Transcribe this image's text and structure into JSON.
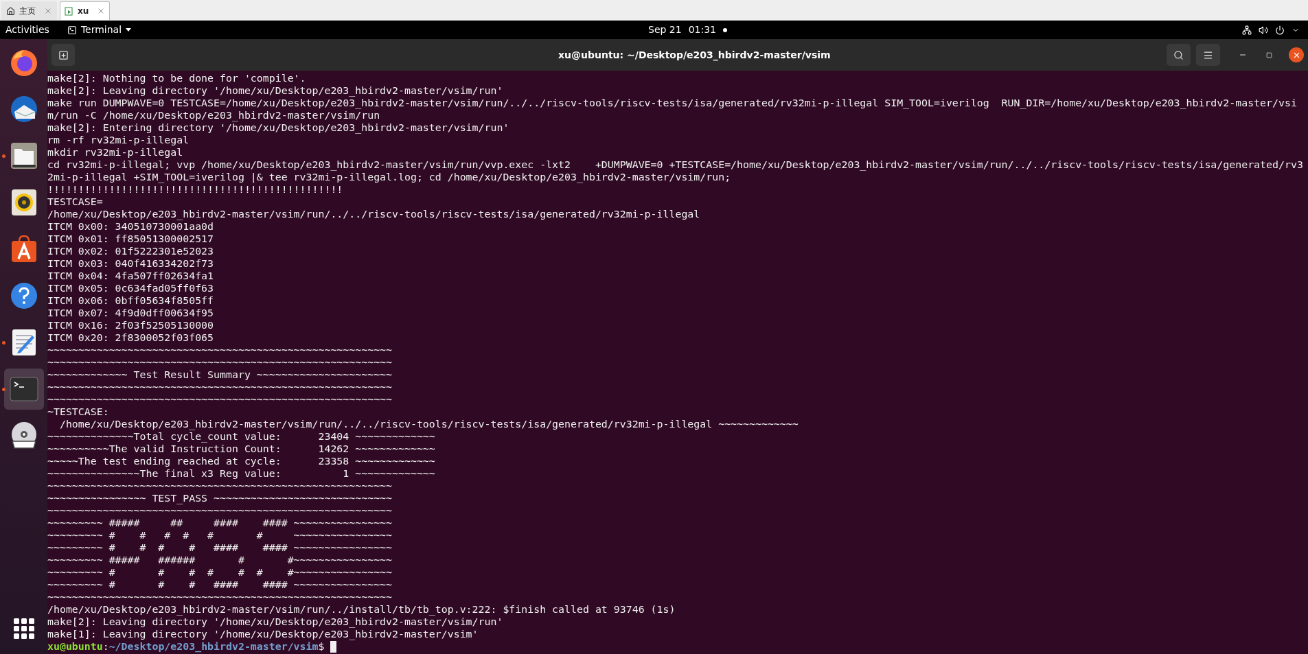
{
  "browser_tabs": [
    {
      "kind": "home",
      "label": "主页",
      "selected": false
    },
    {
      "kind": "page",
      "label": "xu",
      "selected": true
    }
  ],
  "top_bar": {
    "activities": "Activities",
    "app_menu": "Terminal",
    "date": "Sep 21",
    "time": "01:31"
  },
  "dock": {
    "items": [
      {
        "kind": "firefox",
        "running": false,
        "selected": false
      },
      {
        "kind": "mail",
        "running": false,
        "selected": false
      },
      {
        "kind": "files",
        "running": true,
        "selected": false
      },
      {
        "kind": "music",
        "running": false,
        "selected": false
      },
      {
        "kind": "store",
        "running": false,
        "selected": false
      },
      {
        "kind": "help",
        "running": false,
        "selected": false
      },
      {
        "kind": "editor",
        "running": true,
        "selected": false
      },
      {
        "kind": "terminal",
        "running": true,
        "selected": true
      },
      {
        "kind": "dvd",
        "running": false,
        "selected": false
      }
    ]
  },
  "terminal": {
    "title": "xu@ubuntu: ~/Desktop/e203_hbirdv2-master/vsim",
    "lines": [
      "make[2]: Nothing to be done for 'compile'.",
      "make[2]: Leaving directory '/home/xu/Desktop/e203_hbirdv2-master/vsim/run'",
      "make run DUMPWAVE=0 TESTCASE=/home/xu/Desktop/e203_hbirdv2-master/vsim/run/../../riscv-tools/riscv-tests/isa/generated/rv32mi-p-illegal SIM_TOOL=iverilog  RUN_DIR=/home/xu/Desktop/e203_hbirdv2-master/vsi",
      "m/run -C /home/xu/Desktop/e203_hbirdv2-master/vsim/run",
      "make[2]: Entering directory '/home/xu/Desktop/e203_hbirdv2-master/vsim/run'",
      "rm -rf rv32mi-p-illegal",
      "mkdir rv32mi-p-illegal",
      "cd rv32mi-p-illegal; vvp /home/xu/Desktop/e203_hbirdv2-master/vsim/run/vvp.exec -lxt2    +DUMPWAVE=0 +TESTCASE=/home/xu/Desktop/e203_hbirdv2-master/vsim/run/../../riscv-tools/riscv-tests/isa/generated/rv3",
      "2mi-p-illegal +SIM_TOOL=iverilog |& tee rv32mi-p-illegal.log; cd /home/xu/Desktop/e203_hbirdv2-master/vsim/run;",
      "!!!!!!!!!!!!!!!!!!!!!!!!!!!!!!!!!!!!!!!!!!!!!!!!",
      "TESTCASE=",
      "/home/xu/Desktop/e203_hbirdv2-master/vsim/run/../../riscv-tools/riscv-tests/isa/generated/rv32mi-p-illegal",
      "ITCM 0x00: 340510730001aa0d",
      "ITCM 0x01: ff85051300002517",
      "ITCM 0x02: 01f5222301e52023",
      "ITCM 0x03: 040f416334202f73",
      "ITCM 0x04: 4fa507ff02634fa1",
      "ITCM 0x05: 0c634fad05ff0f63",
      "ITCM 0x06: 0bff05634f8505ff",
      "ITCM 0x07: 4f9d0dff00634f95",
      "ITCM 0x16: 2f03f52505130000",
      "ITCM 0x20: 2f8300052f03f065",
      "~~~~~~~~~~~~~~~~~~~~~~~~~~~~~~~~~~~~~~~~~~~~~~~~~~~~~~~~",
      "~~~~~~~~~~~~~~~~~~~~~~~~~~~~~~~~~~~~~~~~~~~~~~~~~~~~~~~~",
      "~~~~~~~~~~~~~ Test Result Summary ~~~~~~~~~~~~~~~~~~~~~~",
      "~~~~~~~~~~~~~~~~~~~~~~~~~~~~~~~~~~~~~~~~~~~~~~~~~~~~~~~~",
      "~~~~~~~~~~~~~~~~~~~~~~~~~~~~~~~~~~~~~~~~~~~~~~~~~~~~~~~~",
      "~TESTCASE:",
      "  /home/xu/Desktop/e203_hbirdv2-master/vsim/run/../../riscv-tools/riscv-tests/isa/generated/rv32mi-p-illegal ~~~~~~~~~~~~~",
      "~~~~~~~~~~~~~~Total cycle_count value:      23404 ~~~~~~~~~~~~~",
      "~~~~~~~~~~The valid Instruction Count:      14262 ~~~~~~~~~~~~~",
      "~~~~~The test ending reached at cycle:      23358 ~~~~~~~~~~~~~",
      "~~~~~~~~~~~~~~~The final x3 Reg value:          1 ~~~~~~~~~~~~~",
      "~~~~~~~~~~~~~~~~~~~~~~~~~~~~~~~~~~~~~~~~~~~~~~~~~~~~~~~~",
      "~~~~~~~~~~~~~~~~ TEST_PASS ~~~~~~~~~~~~~~~~~~~~~~~~~~~~~",
      "~~~~~~~~~~~~~~~~~~~~~~~~~~~~~~~~~~~~~~~~~~~~~~~~~~~~~~~~",
      "~~~~~~~~~ #####     ##     ####    #### ~~~~~~~~~~~~~~~~",
      "~~~~~~~~~ #    #   #  #   #       #     ~~~~~~~~~~~~~~~~",
      "~~~~~~~~~ #    #  #    #   ####    #### ~~~~~~~~~~~~~~~~",
      "~~~~~~~~~ #####   ######       #       #~~~~~~~~~~~~~~~~",
      "~~~~~~~~~ #       #    #  #    #  #    #~~~~~~~~~~~~~~~~",
      "~~~~~~~~~ #       #    #   ####    #### ~~~~~~~~~~~~~~~~",
      "~~~~~~~~~~~~~~~~~~~~~~~~~~~~~~~~~~~~~~~~~~~~~~~~~~~~~~~~",
      "/home/xu/Desktop/e203_hbirdv2-master/vsim/run/../install/tb/tb_top.v:222: $finish called at 93746 (1s)",
      "make[2]: Leaving directory '/home/xu/Desktop/e203_hbirdv2-master/vsim/run'",
      "make[1]: Leaving directory '/home/xu/Desktop/e203_hbirdv2-master/vsim'"
    ],
    "prompt": {
      "user_host": "xu@ubuntu",
      "separator": ":",
      "path": "~/Desktop/e203_hbirdv2-master/vsim",
      "symbol": "$"
    }
  }
}
